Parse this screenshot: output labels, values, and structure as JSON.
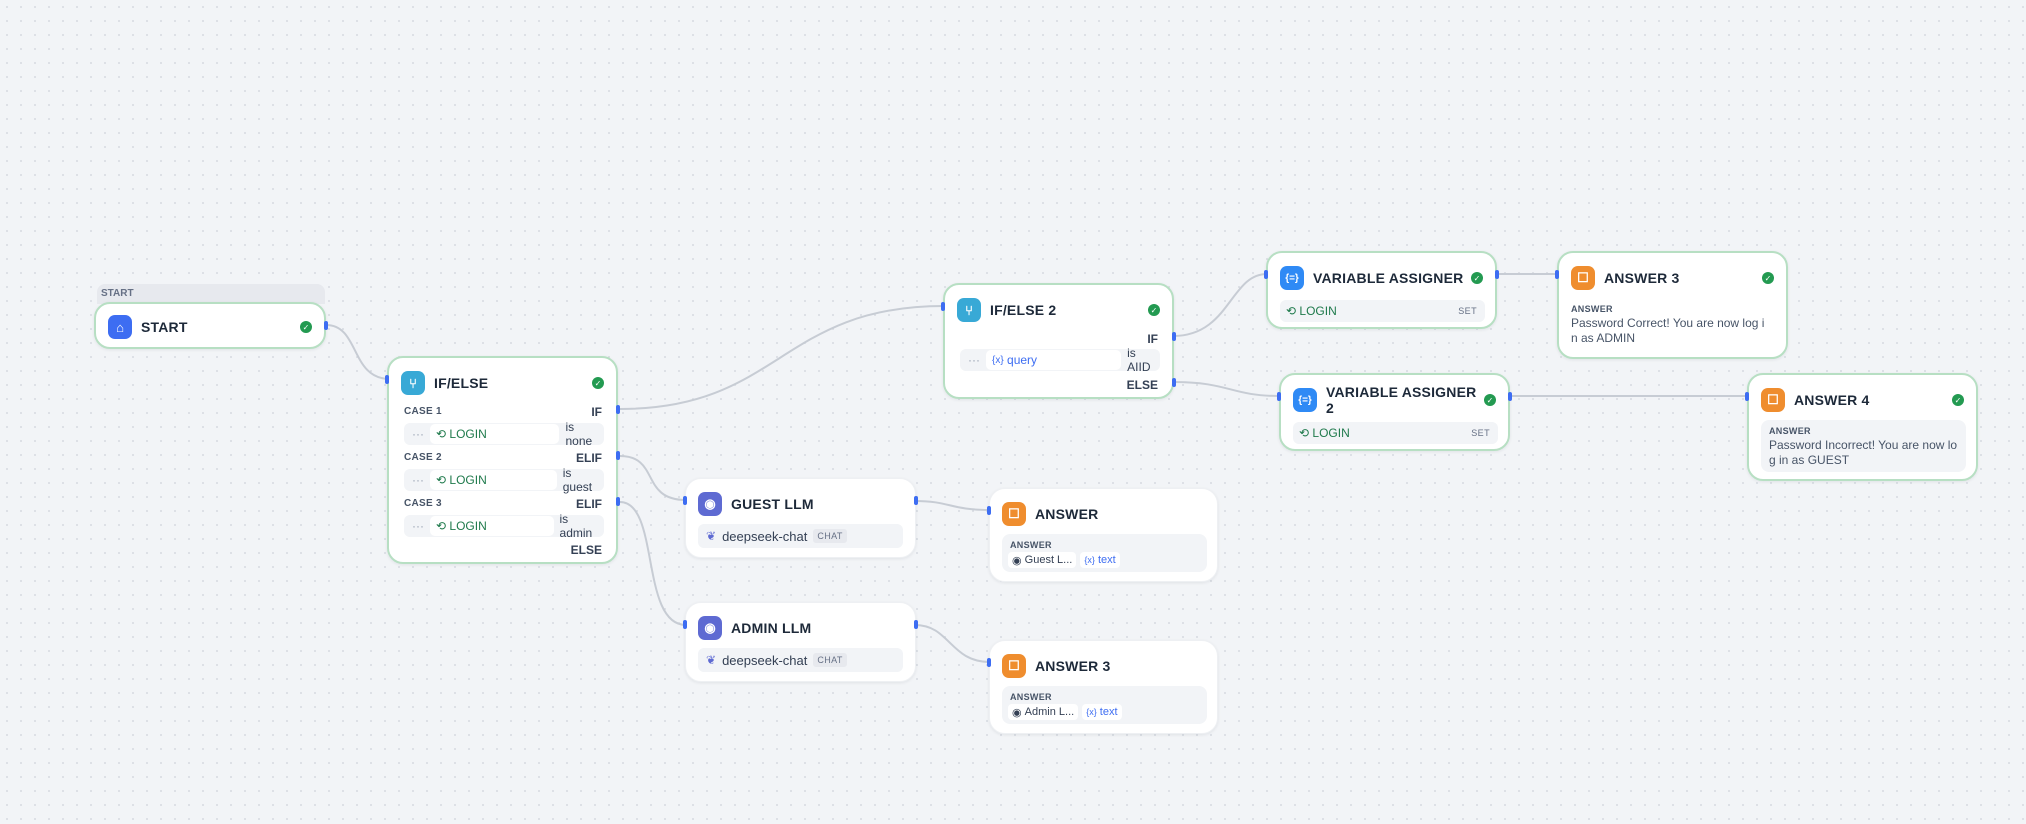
{
  "start_group": {
    "label": "START"
  },
  "nodes": {
    "start": {
      "title": "START"
    },
    "ifelse": {
      "title": "IF/ELSE",
      "cases": [
        {
          "case": "CASE 1",
          "branch": "IF",
          "var": "LOGIN",
          "op": "is none"
        },
        {
          "case": "CASE 2",
          "branch": "ELIF",
          "var": "LOGIN",
          "op": "is guest"
        },
        {
          "case": "CASE 3",
          "branch": "ELIF",
          "var": "LOGIN",
          "op": "is admin"
        }
      ],
      "else": "ELSE"
    },
    "ifelse2": {
      "title": "IF/ELSE 2",
      "branch": "IF",
      "var": "query",
      "var_prefix": "{x}",
      "op": "is AIID",
      "else": "ELSE"
    },
    "va1": {
      "title": "VARIABLE ASSIGNER",
      "var": "LOGIN",
      "tag": "SET"
    },
    "va2": {
      "title": "VARIABLE ASSIGNER 2",
      "var": "LOGIN",
      "tag": "SET"
    },
    "ans3_top": {
      "title": "ANSWER 3",
      "label": "ANSWER",
      "text": "Password Correct! You are now log i n as ADMIN"
    },
    "ans4": {
      "title": "ANSWER 4",
      "label": "ANSWER",
      "text": "Password Incorrect! You are now lo g in as GUEST"
    },
    "guest_llm": {
      "title": "GUEST LLM",
      "model": "deepseek-chat",
      "tag": "CHAT"
    },
    "admin_llm": {
      "title": "ADMIN LLM",
      "model": "deepseek-chat",
      "tag": "CHAT"
    },
    "answer": {
      "title": "ANSWER",
      "label": "ANSWER",
      "src": "Guest L...",
      "var": "text",
      "var_prefix": "{x}"
    },
    "answer3b": {
      "title": "ANSWER 3",
      "label": "ANSWER",
      "src": "Admin L...",
      "var": "text",
      "var_prefix": "{x}"
    }
  },
  "icons": {
    "start": "home-icon",
    "ifelse": "branch-icon",
    "llm": "llm-icon",
    "answer": "answer-icon",
    "assigner": "variable-assigner-icon",
    "check": "check-circle-icon",
    "variable": "variable-icon"
  },
  "colors": {
    "edge": "#c7ccd4",
    "handle": "#3d6df2",
    "selected_border": "#b7dfc3",
    "success": "#239a51"
  }
}
